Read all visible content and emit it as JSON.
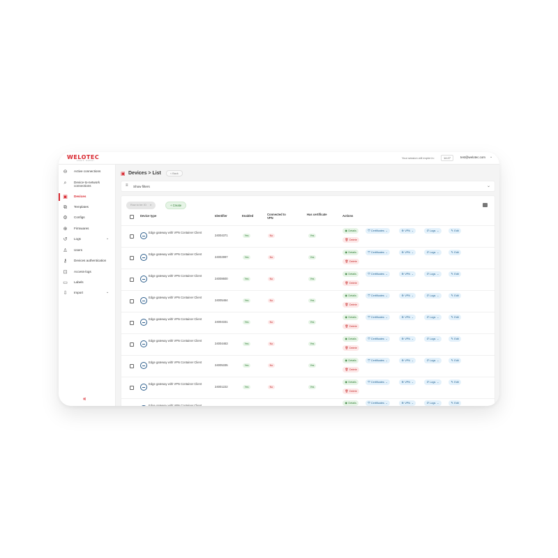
{
  "header": {
    "logo_text": "WELOTEC",
    "logo_tagline": "smart. better.",
    "session_text": "Your session will expire in:",
    "session_timer": "14:27",
    "user_email": "test@welotec.com"
  },
  "sidebar": {
    "items": [
      {
        "label": "Active connections",
        "icon": "link-icon",
        "glyph": "⊖",
        "active": false,
        "has_chevron": false
      },
      {
        "label": "Device-to-network connections",
        "icon": "search-icon",
        "glyph": "⌕",
        "active": false,
        "has_chevron": false
      },
      {
        "label": "Devices",
        "icon": "device-icon",
        "glyph": "▣",
        "active": true,
        "has_chevron": false
      },
      {
        "label": "Templates",
        "icon": "copy-icon",
        "glyph": "⧉",
        "active": false,
        "has_chevron": false
      },
      {
        "label": "Configs",
        "icon": "gear-icon",
        "glyph": "⚙",
        "active": false,
        "has_chevron": false
      },
      {
        "label": "Firmwares",
        "icon": "globe-icon",
        "glyph": "⊕",
        "active": false,
        "has_chevron": false
      },
      {
        "label": "Logs",
        "icon": "history-icon",
        "glyph": "↺",
        "active": false,
        "has_chevron": true
      },
      {
        "label": "Users",
        "icon": "user-icon",
        "glyph": "♙",
        "active": false,
        "has_chevron": false
      },
      {
        "label": "Devices authentication",
        "icon": "key-icon",
        "glyph": "⚷",
        "active": false,
        "has_chevron": false
      },
      {
        "label": "Access-logs",
        "icon": "lock-icon",
        "glyph": "⊡",
        "active": false,
        "has_chevron": false
      },
      {
        "label": "Labels",
        "icon": "label-icon",
        "glyph": "▭",
        "active": false,
        "has_chevron": false
      },
      {
        "label": "Import",
        "icon": "import-icon",
        "glyph": "⇩",
        "active": false,
        "has_chevron": true
      }
    ],
    "collapse_glyph": "«"
  },
  "page": {
    "title": "Devices > List",
    "back_label": "< Back",
    "filters_label": "Show filters",
    "filter_chip": "Row to be: ID",
    "create_label": "+ Create"
  },
  "table": {
    "columns": [
      "Device type",
      "Identifier",
      "Enabled",
      "Connected to VPN",
      "Has certificate",
      "Actions"
    ],
    "rows": [
      {
        "type": "Edge gateway with VPN Container Client",
        "id": "24004371",
        "enabled": "Yes",
        "vpn": "No",
        "cert": "Yes"
      },
      {
        "type": "Edge gateway with VPN Container Client",
        "id": "24002997",
        "enabled": "Yes",
        "vpn": "No",
        "cert": "Yes"
      },
      {
        "type": "Edge gateway with VPN Container Client",
        "id": "24008600",
        "enabled": "Yes",
        "vpn": "No",
        "cert": "Yes"
      },
      {
        "type": "Edge gateway with VPN Container Client",
        "id": "24005464",
        "enabled": "Yes",
        "vpn": "No",
        "cert": "Yes"
      },
      {
        "type": "Edge gateway with VPN Container Client",
        "id": "24004331",
        "enabled": "Yes",
        "vpn": "No",
        "cert": "Yes"
      },
      {
        "type": "Edge gateway with VPN Container Client",
        "id": "24004463",
        "enabled": "Yes",
        "vpn": "No",
        "cert": "Yes"
      },
      {
        "type": "Edge gateway with VPN Container Client",
        "id": "24005335",
        "enabled": "Yes",
        "vpn": "No",
        "cert": "Yes"
      },
      {
        "type": "Edge gateway with VPN Container Client",
        "id": "24001222",
        "enabled": "Yes",
        "vpn": "No",
        "cert": "Yes"
      },
      {
        "type": "Edge gateway with VPN Container Client",
        "id": "",
        "enabled": "",
        "vpn": "",
        "cert": ""
      }
    ],
    "actions": {
      "details": "Details",
      "certificates": "Certificates",
      "vpn": "VPN",
      "logs": "Logs",
      "edit": "Edit",
      "delete": "Delete"
    }
  },
  "colors": {
    "brand": "#d8262e",
    "success": "#2e7d32",
    "danger": "#c62828",
    "info": "#1d5f8f"
  }
}
